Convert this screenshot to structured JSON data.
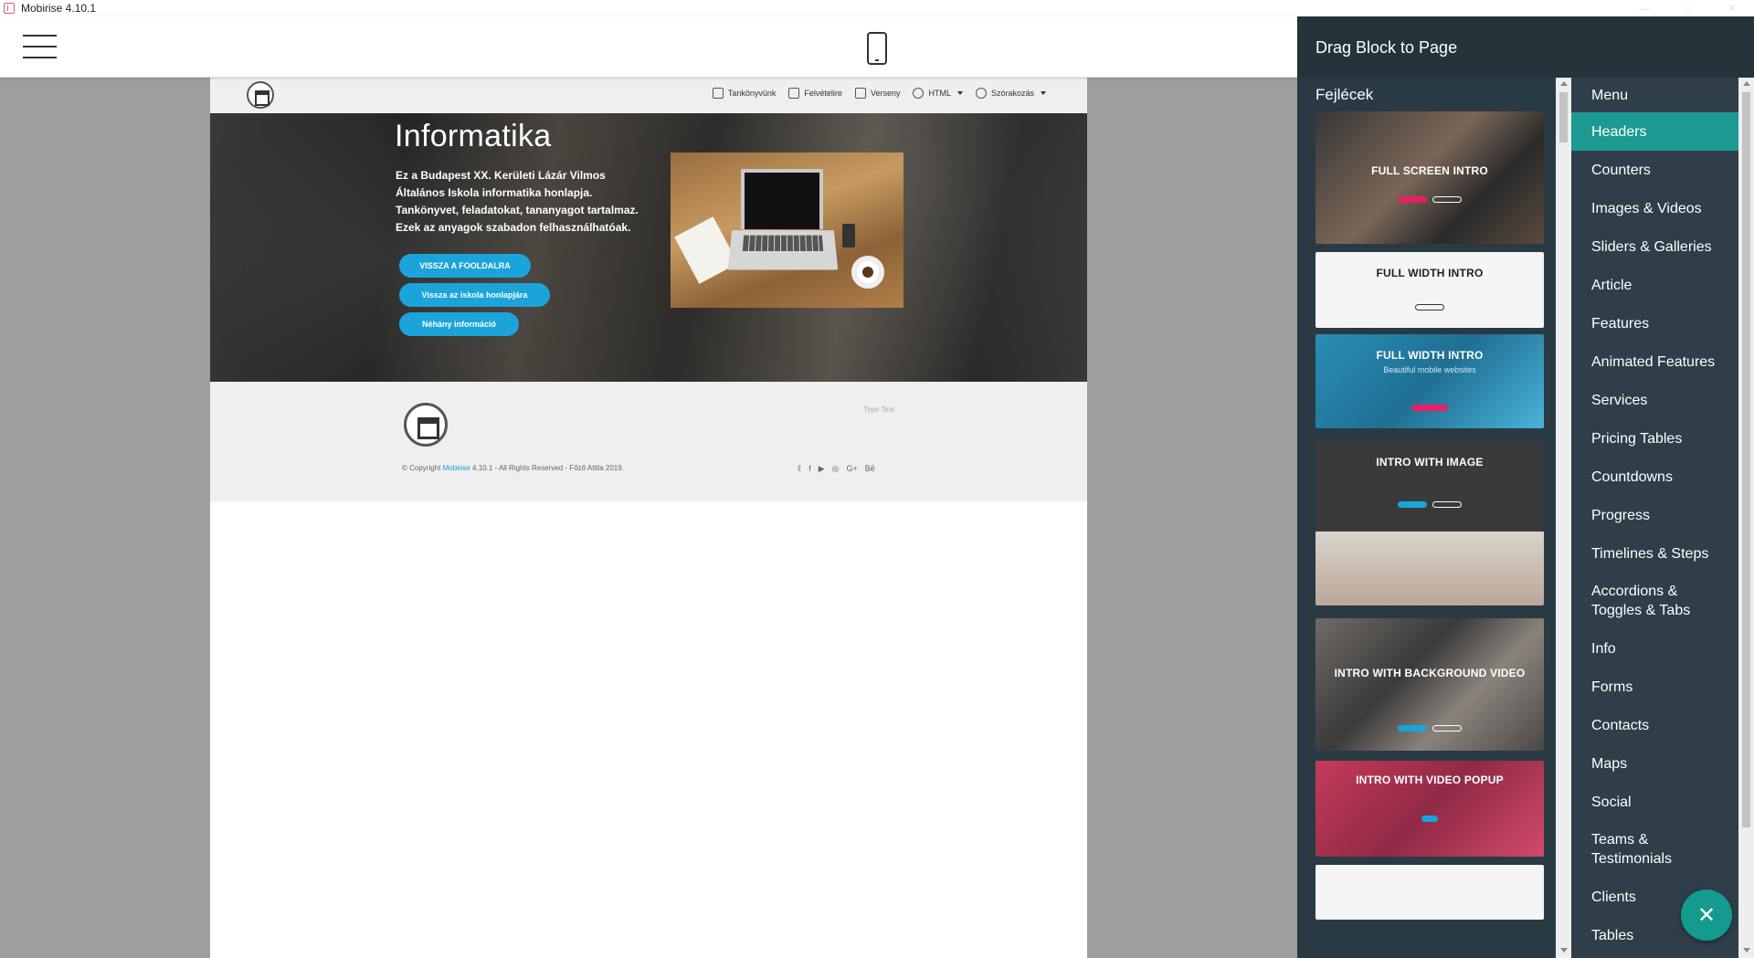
{
  "window": {
    "title": "Mobirise 4.10.1",
    "controls": [
      "—",
      "□",
      "✕"
    ]
  },
  "site": {
    "nav": [
      {
        "label": "Tankönyvünk",
        "icon": "monitor-icon",
        "caret": false
      },
      {
        "label": "Felvételire",
        "icon": "thumbs-up-icon",
        "caret": false
      },
      {
        "label": "Verseny",
        "icon": "rocket-icon",
        "caret": false
      },
      {
        "label": "HTML",
        "icon": "globe-icon",
        "caret": true
      },
      {
        "label": "Szórakozás",
        "icon": "smile-icon",
        "caret": true
      }
    ],
    "hero": {
      "title": "Informatika",
      "lines": [
        "Ez a Budapest XX. Kerületi Lázár Vilmos",
        "Általános Iskola informatika honlapja.",
        "Tankönyvet, feladatokat, tananyagot tartalmaz.",
        "Ezek az anyagok szabadon felhasználhatóak."
      ],
      "buttons": [
        "VISSZA A FOOLDALRA",
        "Vissza az iskola honlapjára",
        "Néhány információ"
      ]
    },
    "footer": {
      "type_text": "Type Text",
      "copyright_prefix": "© Copyright ",
      "copyright_brand": "Mobirise",
      "copyright_suffix": " 4.10.1 - All Rights Reserved - Főző Attila 2019.",
      "social": [
        "𝕥",
        "f",
        "▶",
        "◎",
        "G+",
        "Bē"
      ]
    }
  },
  "panel": {
    "title": "Drag Block to Page",
    "section_label": "Fejlécek",
    "thumbs": [
      {
        "title": "FULL SCREEN INTRO",
        "sub": ""
      },
      {
        "title": "FULL WIDTH INTRO",
        "sub": ""
      },
      {
        "title": "FULL WIDTH INTRO",
        "sub": "Beautiful mobile websites"
      },
      {
        "title": "INTRO WITH IMAGE",
        "sub": ""
      },
      {
        "title": "INTRO WITH BACKGROUND VIDEO",
        "sub": ""
      },
      {
        "title": "INTRO WITH VIDEO POPUP",
        "sub": ""
      }
    ],
    "categories": [
      "Menu",
      "Headers",
      "Counters",
      "Images & Videos",
      "Sliders & Galleries",
      "Article",
      "Features",
      "Animated Features",
      "Services",
      "Pricing Tables",
      "Countdowns",
      "Progress",
      "Timelines & Steps",
      "Accordions & Toggles & Tabs",
      "Info",
      "Forms",
      "Contacts",
      "Maps",
      "Social",
      "Teams & Testimonials",
      "Clients",
      "Tables"
    ],
    "active_category": "Headers",
    "fab": "✕"
  },
  "colors": {
    "accent": "#1c9a92",
    "button": "#1ba4d9",
    "panel_bg": "#2a3a44"
  }
}
